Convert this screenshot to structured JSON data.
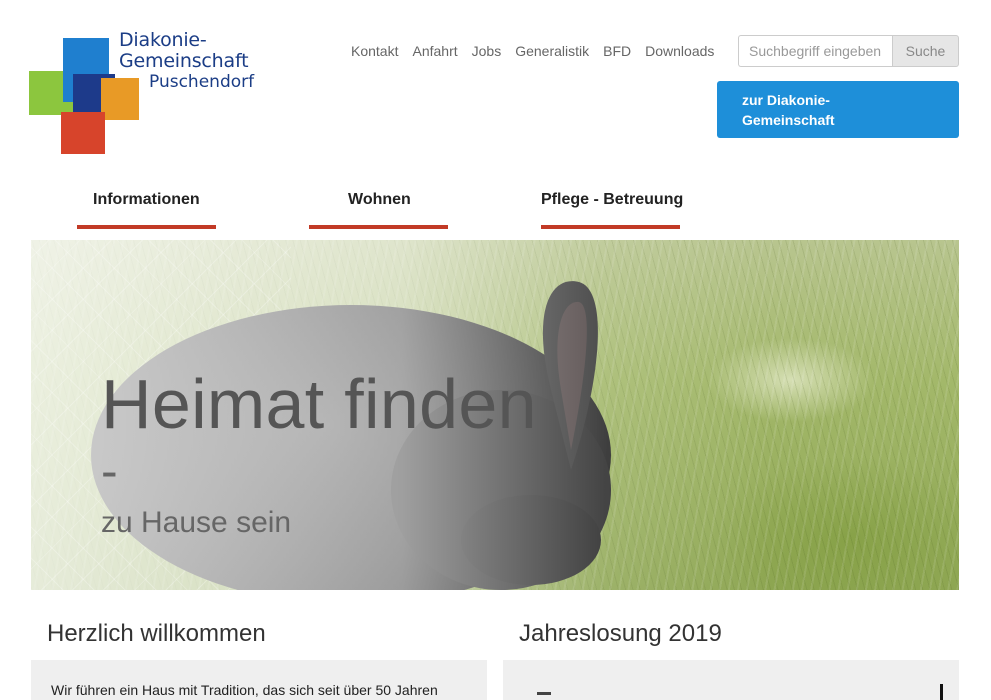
{
  "logo": {
    "line1": "Diakonie-",
    "line2": "Gemeinschaft",
    "line3": "Puschendorf"
  },
  "topnav": [
    "Kontakt",
    "Anfahrt",
    "Jobs",
    "Generalistik",
    "BFD",
    "Downloads"
  ],
  "search": {
    "placeholder": "Suchbegriff eingeben",
    "button": "Suche"
  },
  "cta": {
    "line1": "zur Diakonie-",
    "line2": "Gemeinschaft"
  },
  "mainnav": [
    "Informationen",
    "Wohnen",
    "Pflege - Betreuung"
  ],
  "hero": {
    "title": "Heimat finden",
    "dash": "-",
    "subtitle": "zu Hause sein"
  },
  "sections": {
    "welcome": {
      "title": "Herzlich willkommen",
      "text": "Wir führen ein Haus mit Tradition, das sich seit über 50 Jahren"
    },
    "jahreslosung": {
      "title": "Jahreslosung 2019"
    }
  },
  "colors": {
    "accent_blue": "#1e8fd9",
    "nav_underline": "#c23a26",
    "logo_text": "#1b3d86"
  }
}
